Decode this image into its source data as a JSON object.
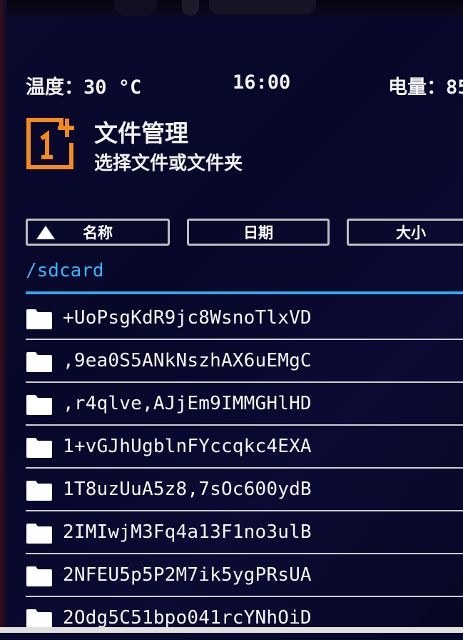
{
  "status_bar": {
    "temperature": "温度：30 °C",
    "time": "16:00",
    "battery": "电量：85"
  },
  "header": {
    "logo": "oneplus-logo-icon",
    "title": "文件管理",
    "subtitle": "选择文件或文件夹"
  },
  "sort": {
    "name_label": "名称",
    "date_label": "日期",
    "size_label": "大小",
    "active_sort_icon": "triangle-up-icon"
  },
  "path": "/sdcard",
  "colors": {
    "path_accent": "#3ab4ff",
    "logo_orange": "#f58a1f",
    "background": "#0a0a2e"
  },
  "files": [
    {
      "icon": "folder-icon",
      "name": "+UoPsgKdR9jc8WsnoTlxVD"
    },
    {
      "icon": "folder-icon",
      "name": ",9ea0S5ANkNszhAX6uEMgC"
    },
    {
      "icon": "folder-icon",
      "name": ",r4qlve,AJjEm9IMMGHlHD"
    },
    {
      "icon": "folder-icon",
      "name": "1+vGJhUgblnFYccqkc4EXA"
    },
    {
      "icon": "folder-icon",
      "name": "1T8uzUuA5z8,7sOc600ydB"
    },
    {
      "icon": "folder-icon",
      "name": "2IMIwjM3Fq4a13F1no3ulB"
    },
    {
      "icon": "folder-icon",
      "name": "2NFEU5p5P2M7ik5ygPRsUA"
    },
    {
      "icon": "folder-icon",
      "name": "2Odg5C51bpo041rcYNhOiD"
    }
  ]
}
